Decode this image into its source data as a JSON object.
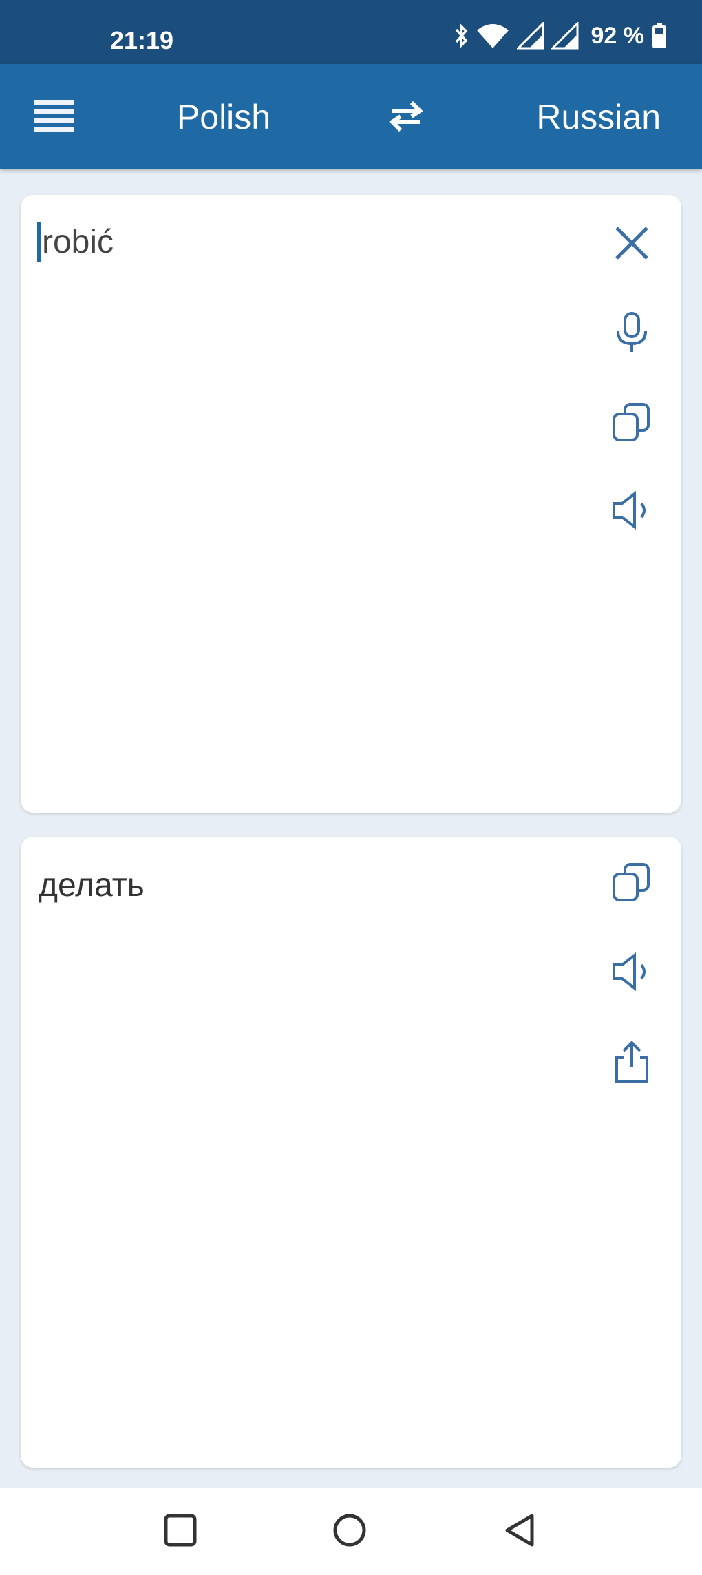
{
  "status_bar": {
    "time": "21:19",
    "battery": "92 %",
    "icons": [
      "bluetooth-icon",
      "wifi-icon",
      "signal-icon",
      "signal-icon",
      "battery-icon"
    ]
  },
  "app_bar": {
    "menu_icon": "menu-icon",
    "source_language": "Polish",
    "swap_icon": "swap-icon",
    "target_language": "Russian"
  },
  "input_card": {
    "text": "robić",
    "actions": [
      "close-icon",
      "microphone-icon",
      "copy-icon",
      "speaker-icon"
    ]
  },
  "output_card": {
    "text": "делать",
    "actions": [
      "copy-icon",
      "speaker-icon",
      "share-icon"
    ]
  },
  "nav_bar": {
    "buttons": [
      "recents-square-icon",
      "home-circle-icon",
      "back-triangle-icon"
    ]
  },
  "colors": {
    "status_bar": "#1b4e7c",
    "app_bar": "#1f6aa5",
    "background": "#e8eef5",
    "icon": "#3a6ea5"
  }
}
